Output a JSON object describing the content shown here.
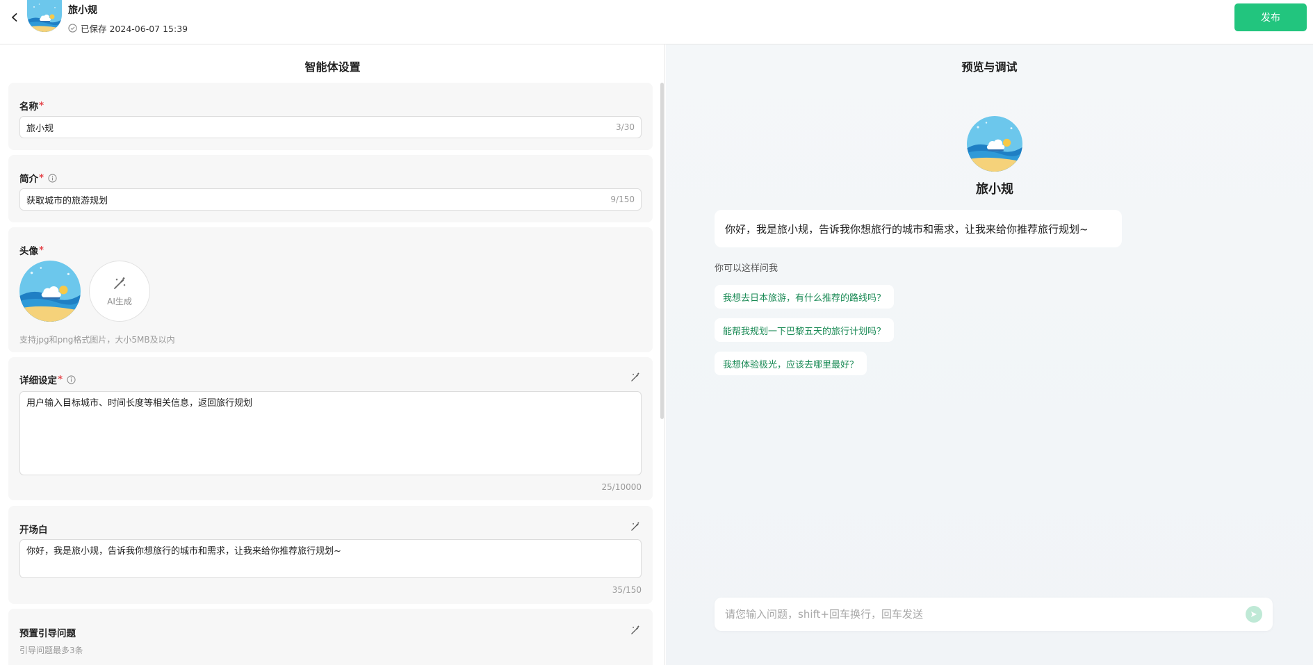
{
  "header": {
    "name": "旅小规",
    "save_status": "已保存 2024-06-07 15:39",
    "publish_label": "发布"
  },
  "settings": {
    "title": "智能体设置",
    "name_field": {
      "label": "名称",
      "value": "旅小规",
      "counter": "3/30"
    },
    "intro_field": {
      "label": "简介",
      "value": "获取城市的旅游规划",
      "counter": "9/150"
    },
    "avatar_field": {
      "label": "头像",
      "ai_label": "AI生成",
      "hint": "支持jpg和png格式图片，大小5MB及以内"
    },
    "detail_field": {
      "label": "详细设定",
      "value": "用户输入目标城市、时间长度等相关信息，返回旅行规划",
      "counter": "25/10000"
    },
    "opening_field": {
      "label": "开场白",
      "value": "你好，我是旅小规，告诉我你想旅行的城市和需求，让我来给你推荐旅行规划~",
      "counter": "35/150"
    },
    "guide_field": {
      "label": "预置引导问题",
      "hint": "引导问题最多3条"
    }
  },
  "preview": {
    "title": "预览与调试",
    "bot_name": "旅小规",
    "greeting": "你好，我是旅小规，告诉我你想旅行的城市和需求，让我来给你推荐旅行规划~",
    "suggest_label": "你可以这样问我",
    "suggestions": [
      "我想去日本旅游，有什么推荐的路线吗？",
      "能帮我规划一下巴黎五天的旅行计划吗？",
      "我想体验极光，应该去哪里最好？"
    ],
    "input_placeholder": "请您输入问题，shift+回车换行，回车发送"
  },
  "colors": {
    "accent": "#22c57e",
    "suggestion_text": "#1a8a55",
    "required": "#e5484d"
  }
}
